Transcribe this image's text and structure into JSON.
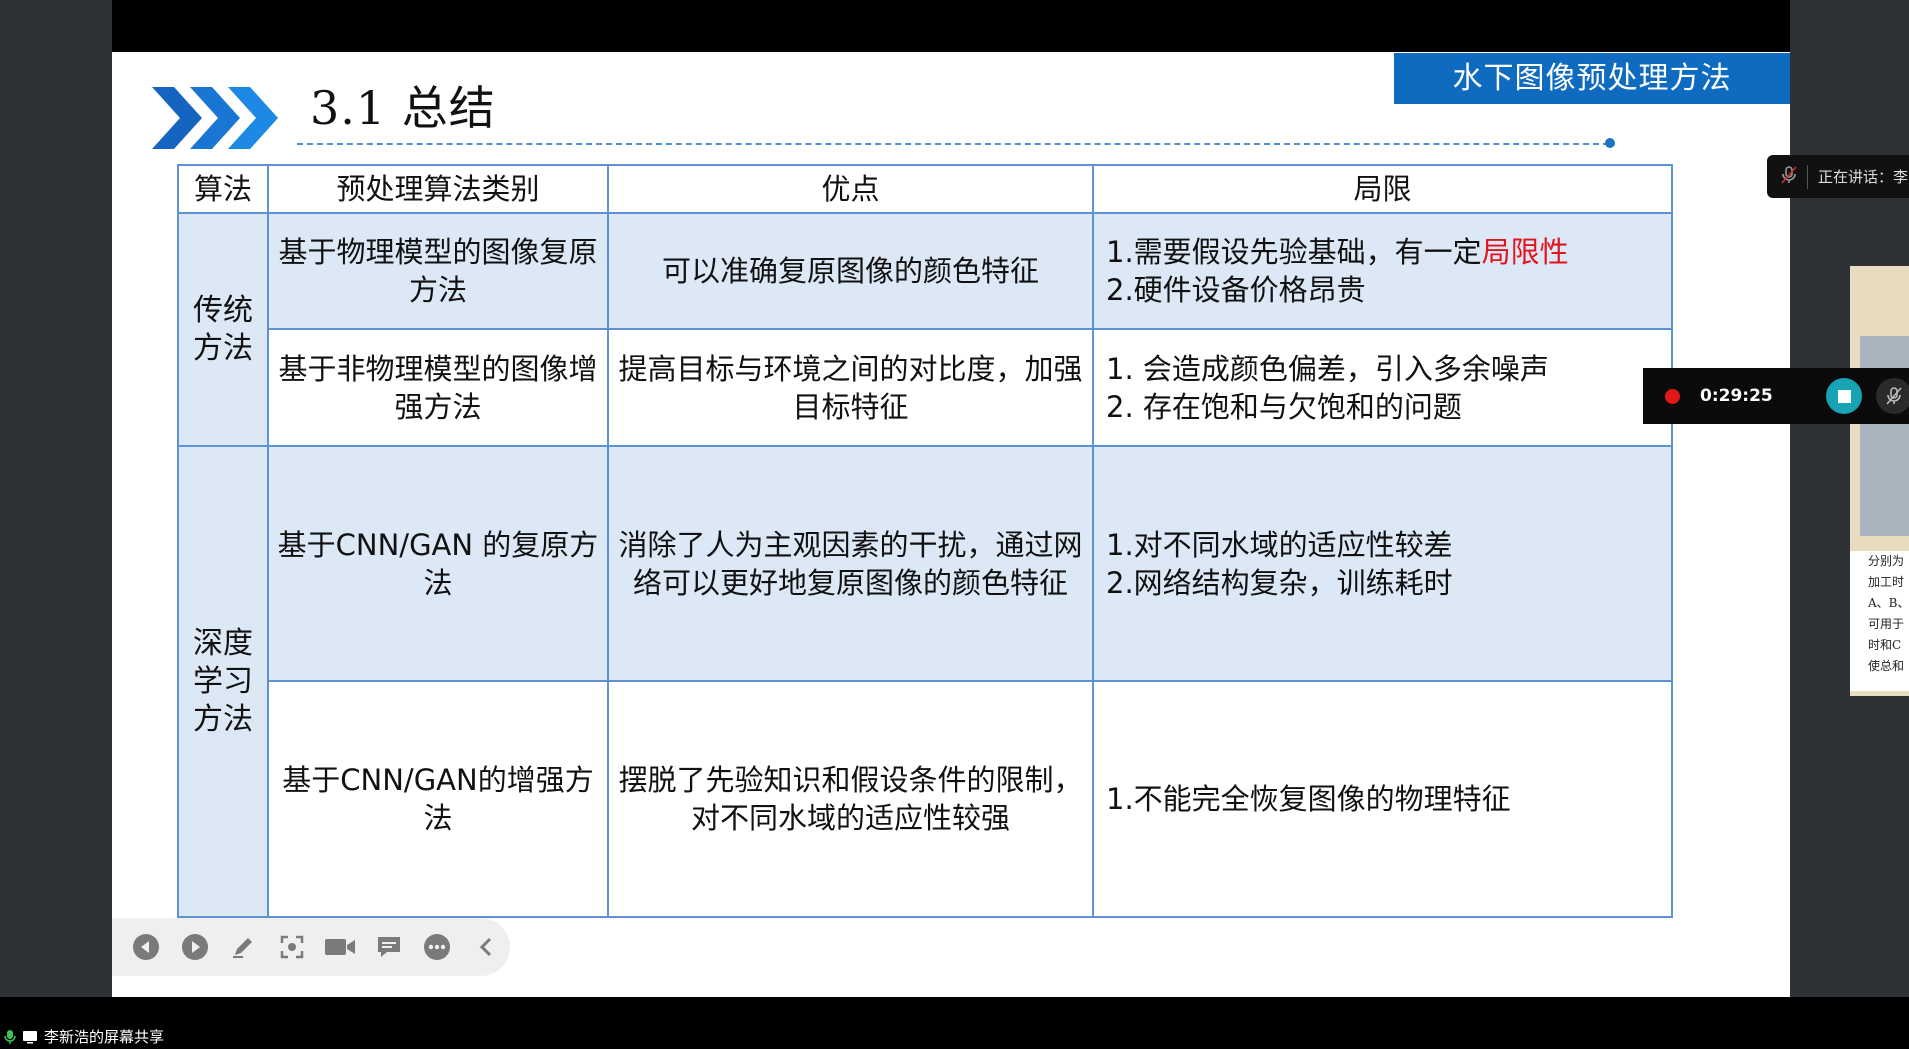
{
  "slide": {
    "title": "3.1 总结",
    "section_label": "水下图像预处理方法"
  },
  "table": {
    "headers": [
      "算法",
      "预处理算法类别",
      "优点",
      "局限"
    ],
    "groups": [
      {
        "category": "传统方法",
        "rows": [
          {
            "type": "基于物理模型的图像复原方法",
            "pros": "可以准确复原图像的颜色特征",
            "limits_line1_prefix": "1.需要假设先验基础，有一定",
            "limits_line1_highlight": "局限性",
            "limits_line2": "2.硬件设备价格昂贵"
          },
          {
            "type": "基于非物理模型的图像增强方法",
            "pros": "提高目标与环境之间的对比度，加强目标特征",
            "limits_line1": "1. 会造成颜色偏差，引入多余噪声",
            "limits_line2": "2. 存在饱和与欠饱和的问题"
          }
        ]
      },
      {
        "category": "深度学习方法",
        "rows": [
          {
            "type": "基于CNN/GAN 的复原方法",
            "pros": "消除了人为主观因素的干扰，通过网络可以更好地复原图像的颜色特征",
            "limits_line1": "1.对不同水域的适应性较差",
            "limits_line2": "2.网络结构复杂，训练耗时"
          },
          {
            "type": "基于CNN/GAN的增强方法",
            "pros": "摆脱了先验知识和假设条件的限制，对不同水域的适应性较强",
            "limits_line1": "1.不能完全恢复图像的物理特征"
          }
        ]
      }
    ]
  },
  "meeting": {
    "speaking_label": "正在讲话：李",
    "recording_time": "0:29:25",
    "share_label": "李新浩的屏幕共享",
    "thumb_text": [
      "分别为",
      "加工时",
      "A、B、",
      "可用于",
      "时和C",
      "使总和"
    ]
  },
  "colors": {
    "accent": "#0e6bbf",
    "table_border": "#5e93d3",
    "row_shade": "#dde8f6",
    "highlight": "#e1131d"
  },
  "toolbar_icons": [
    "prev-icon",
    "next-icon",
    "pen-icon",
    "zoom-icon",
    "camera-icon",
    "comment-icon",
    "more-icon",
    "collapse-icon"
  ]
}
